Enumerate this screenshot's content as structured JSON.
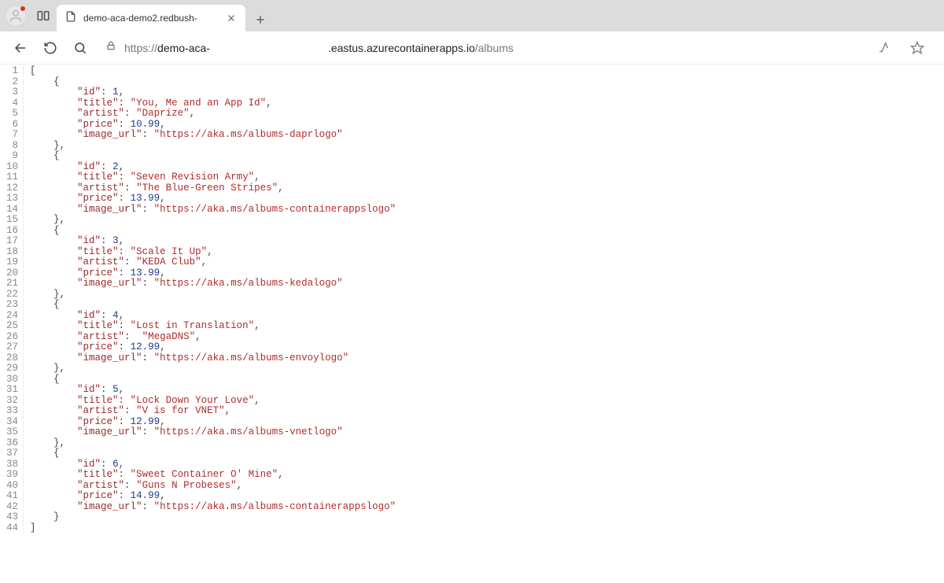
{
  "browser": {
    "tab_title": "demo-aca-demo2.redbush-",
    "url_prefix": "https://",
    "url_seg1": "demo-aca-",
    "url_seg2": ".eastus.azurecontainerapps.io",
    "url_path": "/albums"
  },
  "json_lines": [
    {
      "n": 1,
      "indent": 0,
      "parts": [
        {
          "t": "p",
          "v": "["
        }
      ]
    },
    {
      "n": 2,
      "indent": 1,
      "parts": [
        {
          "t": "p",
          "v": "{"
        }
      ]
    },
    {
      "n": 3,
      "indent": 2,
      "parts": [
        {
          "t": "k",
          "v": "\"id\""
        },
        {
          "t": "p",
          "v": ": "
        },
        {
          "t": "n",
          "v": "1"
        },
        {
          "t": "p",
          "v": ","
        }
      ]
    },
    {
      "n": 4,
      "indent": 2,
      "parts": [
        {
          "t": "k",
          "v": "\"title\""
        },
        {
          "t": "p",
          "v": ": "
        },
        {
          "t": "s",
          "v": "\"You, Me and an App Id\""
        },
        {
          "t": "p",
          "v": ","
        }
      ]
    },
    {
      "n": 5,
      "indent": 2,
      "parts": [
        {
          "t": "k",
          "v": "\"artist\""
        },
        {
          "t": "p",
          "v": ": "
        },
        {
          "t": "s",
          "v": "\"Daprize\""
        },
        {
          "t": "p",
          "v": ","
        }
      ]
    },
    {
      "n": 6,
      "indent": 2,
      "parts": [
        {
          "t": "k",
          "v": "\"price\""
        },
        {
          "t": "p",
          "v": ": "
        },
        {
          "t": "n",
          "v": "10.99"
        },
        {
          "t": "p",
          "v": ","
        }
      ]
    },
    {
      "n": 7,
      "indent": 2,
      "parts": [
        {
          "t": "k",
          "v": "\"image_url\""
        },
        {
          "t": "p",
          "v": ": "
        },
        {
          "t": "s",
          "v": "\"https://aka.ms/albums-daprlogo\""
        }
      ]
    },
    {
      "n": 8,
      "indent": 1,
      "parts": [
        {
          "t": "p",
          "v": "},"
        }
      ]
    },
    {
      "n": 9,
      "indent": 1,
      "parts": [
        {
          "t": "p",
          "v": "{"
        }
      ]
    },
    {
      "n": 10,
      "indent": 2,
      "parts": [
        {
          "t": "k",
          "v": "\"id\""
        },
        {
          "t": "p",
          "v": ": "
        },
        {
          "t": "n",
          "v": "2"
        },
        {
          "t": "p",
          "v": ","
        }
      ]
    },
    {
      "n": 11,
      "indent": 2,
      "parts": [
        {
          "t": "k",
          "v": "\"title\""
        },
        {
          "t": "p",
          "v": ": "
        },
        {
          "t": "s",
          "v": "\"Seven Revision Army\""
        },
        {
          "t": "p",
          "v": ","
        }
      ]
    },
    {
      "n": 12,
      "indent": 2,
      "parts": [
        {
          "t": "k",
          "v": "\"artist\""
        },
        {
          "t": "p",
          "v": ": "
        },
        {
          "t": "s",
          "v": "\"The Blue-Green Stripes\""
        },
        {
          "t": "p",
          "v": ","
        }
      ]
    },
    {
      "n": 13,
      "indent": 2,
      "parts": [
        {
          "t": "k",
          "v": "\"price\""
        },
        {
          "t": "p",
          "v": ": "
        },
        {
          "t": "n",
          "v": "13.99"
        },
        {
          "t": "p",
          "v": ","
        }
      ]
    },
    {
      "n": 14,
      "indent": 2,
      "parts": [
        {
          "t": "k",
          "v": "\"image_url\""
        },
        {
          "t": "p",
          "v": ": "
        },
        {
          "t": "s",
          "v": "\"https://aka.ms/albums-containerappslogo\""
        }
      ]
    },
    {
      "n": 15,
      "indent": 1,
      "parts": [
        {
          "t": "p",
          "v": "},"
        }
      ]
    },
    {
      "n": 16,
      "indent": 1,
      "parts": [
        {
          "t": "p",
          "v": "{"
        }
      ]
    },
    {
      "n": 17,
      "indent": 2,
      "parts": [
        {
          "t": "k",
          "v": "\"id\""
        },
        {
          "t": "p",
          "v": ": "
        },
        {
          "t": "n",
          "v": "3"
        },
        {
          "t": "p",
          "v": ","
        }
      ]
    },
    {
      "n": 18,
      "indent": 2,
      "parts": [
        {
          "t": "k",
          "v": "\"title\""
        },
        {
          "t": "p",
          "v": ": "
        },
        {
          "t": "s",
          "v": "\"Scale It Up\""
        },
        {
          "t": "p",
          "v": ","
        }
      ]
    },
    {
      "n": 19,
      "indent": 2,
      "parts": [
        {
          "t": "k",
          "v": "\"artist\""
        },
        {
          "t": "p",
          "v": ": "
        },
        {
          "t": "s",
          "v": "\"KEDA Club\""
        },
        {
          "t": "p",
          "v": ","
        }
      ]
    },
    {
      "n": 20,
      "indent": 2,
      "parts": [
        {
          "t": "k",
          "v": "\"price\""
        },
        {
          "t": "p",
          "v": ": "
        },
        {
          "t": "n",
          "v": "13.99"
        },
        {
          "t": "p",
          "v": ","
        }
      ]
    },
    {
      "n": 21,
      "indent": 2,
      "parts": [
        {
          "t": "k",
          "v": "\"image_url\""
        },
        {
          "t": "p",
          "v": ": "
        },
        {
          "t": "s",
          "v": "\"https://aka.ms/albums-kedalogo\""
        }
      ]
    },
    {
      "n": 22,
      "indent": 1,
      "parts": [
        {
          "t": "p",
          "v": "},"
        }
      ]
    },
    {
      "n": 23,
      "indent": 1,
      "parts": [
        {
          "t": "p",
          "v": "{"
        }
      ]
    },
    {
      "n": 24,
      "indent": 2,
      "parts": [
        {
          "t": "k",
          "v": "\"id\""
        },
        {
          "t": "p",
          "v": ": "
        },
        {
          "t": "n",
          "v": "4"
        },
        {
          "t": "p",
          "v": ","
        }
      ]
    },
    {
      "n": 25,
      "indent": 2,
      "parts": [
        {
          "t": "k",
          "v": "\"title\""
        },
        {
          "t": "p",
          "v": ": "
        },
        {
          "t": "s",
          "v": "\"Lost in Translation\""
        },
        {
          "t": "p",
          "v": ","
        }
      ]
    },
    {
      "n": 26,
      "indent": 2,
      "parts": [
        {
          "t": "k",
          "v": "\"artist\""
        },
        {
          "t": "p",
          "v": ":  "
        },
        {
          "t": "s",
          "v": "\"MegaDNS\""
        },
        {
          "t": "p",
          "v": ","
        }
      ]
    },
    {
      "n": 27,
      "indent": 2,
      "parts": [
        {
          "t": "k",
          "v": "\"price\""
        },
        {
          "t": "p",
          "v": ": "
        },
        {
          "t": "n",
          "v": "12.99"
        },
        {
          "t": "p",
          "v": ","
        }
      ]
    },
    {
      "n": 28,
      "indent": 2,
      "parts": [
        {
          "t": "k",
          "v": "\"image_url\""
        },
        {
          "t": "p",
          "v": ": "
        },
        {
          "t": "s",
          "v": "\"https://aka.ms/albums-envoylogo\""
        }
      ]
    },
    {
      "n": 29,
      "indent": 1,
      "parts": [
        {
          "t": "p",
          "v": "},"
        }
      ]
    },
    {
      "n": 30,
      "indent": 1,
      "parts": [
        {
          "t": "p",
          "v": "{"
        }
      ]
    },
    {
      "n": 31,
      "indent": 2,
      "parts": [
        {
          "t": "k",
          "v": "\"id\""
        },
        {
          "t": "p",
          "v": ": "
        },
        {
          "t": "n",
          "v": "5"
        },
        {
          "t": "p",
          "v": ","
        }
      ]
    },
    {
      "n": 32,
      "indent": 2,
      "parts": [
        {
          "t": "k",
          "v": "\"title\""
        },
        {
          "t": "p",
          "v": ": "
        },
        {
          "t": "s",
          "v": "\"Lock Down Your Love\""
        },
        {
          "t": "p",
          "v": ","
        }
      ]
    },
    {
      "n": 33,
      "indent": 2,
      "parts": [
        {
          "t": "k",
          "v": "\"artist\""
        },
        {
          "t": "p",
          "v": ": "
        },
        {
          "t": "s",
          "v": "\"V is for VNET\""
        },
        {
          "t": "p",
          "v": ","
        }
      ]
    },
    {
      "n": 34,
      "indent": 2,
      "parts": [
        {
          "t": "k",
          "v": "\"price\""
        },
        {
          "t": "p",
          "v": ": "
        },
        {
          "t": "n",
          "v": "12.99"
        },
        {
          "t": "p",
          "v": ","
        }
      ]
    },
    {
      "n": 35,
      "indent": 2,
      "parts": [
        {
          "t": "k",
          "v": "\"image_url\""
        },
        {
          "t": "p",
          "v": ": "
        },
        {
          "t": "s",
          "v": "\"https://aka.ms/albums-vnetlogo\""
        }
      ]
    },
    {
      "n": 36,
      "indent": 1,
      "parts": [
        {
          "t": "p",
          "v": "},"
        }
      ]
    },
    {
      "n": 37,
      "indent": 1,
      "parts": [
        {
          "t": "p",
          "v": "{"
        }
      ]
    },
    {
      "n": 38,
      "indent": 2,
      "parts": [
        {
          "t": "k",
          "v": "\"id\""
        },
        {
          "t": "p",
          "v": ": "
        },
        {
          "t": "n",
          "v": "6"
        },
        {
          "t": "p",
          "v": ","
        }
      ]
    },
    {
      "n": 39,
      "indent": 2,
      "parts": [
        {
          "t": "k",
          "v": "\"title\""
        },
        {
          "t": "p",
          "v": ": "
        },
        {
          "t": "s",
          "v": "\"Sweet Container O' Mine\""
        },
        {
          "t": "p",
          "v": ","
        }
      ]
    },
    {
      "n": 40,
      "indent": 2,
      "parts": [
        {
          "t": "k",
          "v": "\"artist\""
        },
        {
          "t": "p",
          "v": ": "
        },
        {
          "t": "s",
          "v": "\"Guns N Probeses\""
        },
        {
          "t": "p",
          "v": ","
        }
      ]
    },
    {
      "n": 41,
      "indent": 2,
      "parts": [
        {
          "t": "k",
          "v": "\"price\""
        },
        {
          "t": "p",
          "v": ": "
        },
        {
          "t": "n",
          "v": "14.99"
        },
        {
          "t": "p",
          "v": ","
        }
      ]
    },
    {
      "n": 42,
      "indent": 2,
      "parts": [
        {
          "t": "k",
          "v": "\"image_url\""
        },
        {
          "t": "p",
          "v": ": "
        },
        {
          "t": "s",
          "v": "\"https://aka.ms/albums-containerappslogo\""
        }
      ]
    },
    {
      "n": 43,
      "indent": 1,
      "parts": [
        {
          "t": "p",
          "v": "}"
        }
      ]
    },
    {
      "n": 44,
      "indent": 0,
      "parts": [
        {
          "t": "p",
          "v": "]"
        }
      ]
    }
  ]
}
